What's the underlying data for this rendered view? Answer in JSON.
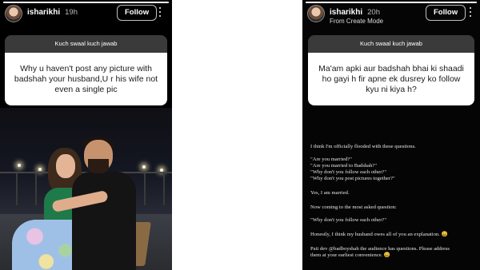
{
  "left": {
    "username": "isharikhi",
    "time": "19h",
    "follow_label": "Follow",
    "question_header": "Kuch swaal kuch jawab",
    "question_text": "Why u haven't post any picture with badshah your husband,U r his wife not even a single pic"
  },
  "right": {
    "username": "isharikhi",
    "time": "20h",
    "mode": "From Create Mode",
    "follow_label": "Follow",
    "question_header": "Kuch swaal kuch jawab",
    "question_text": "Ma'am apki aur badshah bhai ki shaadi ho gayi h fir apne ek dusrey ko follow kyu ni kiya h?",
    "lines": [
      "I think I'm officially flooded with these questions.",
      "\"Are you married?\"",
      "\"Are you married to Badshah?\"",
      "\"Why don't you follow each other?\"",
      "\"Why don't you post pictures together?\"",
      "Yes, I am married.",
      "Now coming to the most asked question:",
      "\"Why don't you follow each other?\"",
      "Honestly, I think my husband owes all of you an explanation. 😄",
      "Pati dev @badboyshah the audience has questions. Please address",
      "them at your earliest convenience. 😄"
    ]
  },
  "icons": {
    "more": "more-vertical-icon"
  }
}
